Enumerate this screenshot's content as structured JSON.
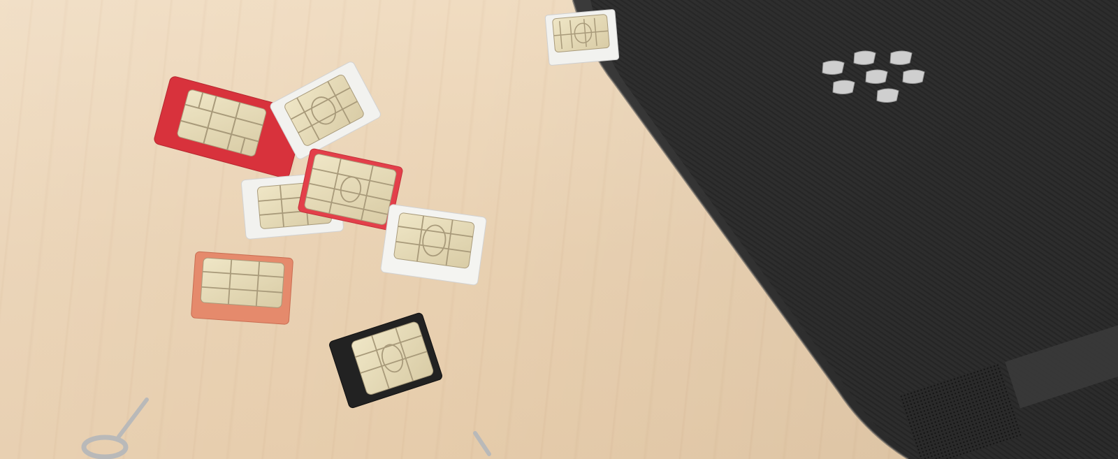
{
  "scene": {
    "subject": "sim-cards-and-phone",
    "colors": {
      "wood": "#e9d2b3",
      "phone_body": "#2f2f2f",
      "phone_texture": "#262626",
      "logo": "#cfcfcf",
      "chip_gold": "#e6dbb8",
      "chip_line": "#a89a7a",
      "sim_red": "#d8323c",
      "sim_white": "#f2f2ef",
      "sim_orange": "#e58a6c",
      "sim_black": "#222222",
      "metal": "#b9b9b9"
    },
    "icons": {
      "brand_logo": "blackberry-logo-icon",
      "tool": "sim-eject-tool-icon"
    }
  }
}
